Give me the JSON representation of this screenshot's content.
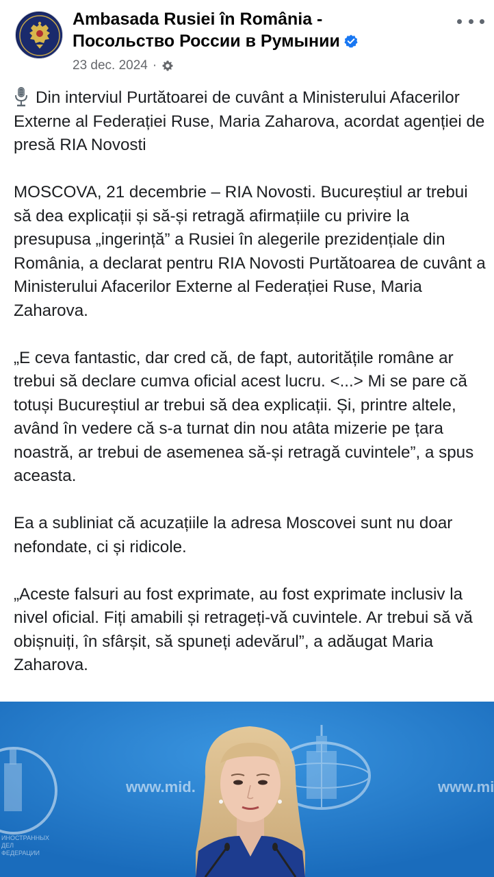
{
  "post": {
    "author": {
      "name_line1": "Ambasada Rusiei în România -",
      "name_line2": "Посольство России в Румынии",
      "verified": true,
      "avatar_icon": "embassy-emblem-icon"
    },
    "date": "23 dec. 2024",
    "separator": "·",
    "audience_icon": "gear-icon",
    "more_icon": "more-options-icon",
    "paragraphs": [
      "Din interviul Purtătoarei de cuvânt a Ministerului Afacerilor Externe al Federației Ruse, Maria Zaharova, acordat agenției de presă RIA Novosti",
      "MOSCOVA, 21 decembrie – RIA Novosti. Bucureștiul ar trebui să dea explicații și să-și retragă afirmațiile cu privire la presupusa „ingerință” a Rusiei în alegerile prezidențiale din România, a declarat pentru RIA Novosti Purtătoarea de cuvânt a Ministerului Afacerilor Externe al Federației Ruse, Maria Zaharova.",
      "„E ceva fantastic, dar cred că, de fapt, autoritățile române ar trebui să declare cumva oficial acest lucru. <...> Mi se pare că totuși Bucureștiul ar trebui să dea explicații. Și, printre altele, având în vedere că s-a turnat din nou atâta mizerie pe țara noastră, ar trebui de asemenea să-și retragă cuvintele”, a spus aceasta.",
      "Ea a subliniat că acuzațiile la adresa Moscovei sunt nu doar nefondate, ci și ridicole.",
      "„Aceste falsuri au fost exprimate, au fost exprimate inclusiv la nivel oficial. Fiți amabili și retrageți-vă cuvintele. Ar trebui să vă obișnuiți, în sfârșit, să spuneți adevărul”, a adăugat Maria Zaharova."
    ],
    "lead_icon": "microphone-icon",
    "photo": {
      "watermark_left": "www.mid.",
      "watermark_right": "www.mi",
      "backdrop_left_caption": "ИНОСТРАННЫХ ДЕЛ\nФЕДЕРАЦИИ"
    }
  },
  "colors": {
    "text": "#1c1e21",
    "meta": "#65676b",
    "verified_badge": "#1877f2",
    "photo_backdrop": "#1f7ccf"
  }
}
